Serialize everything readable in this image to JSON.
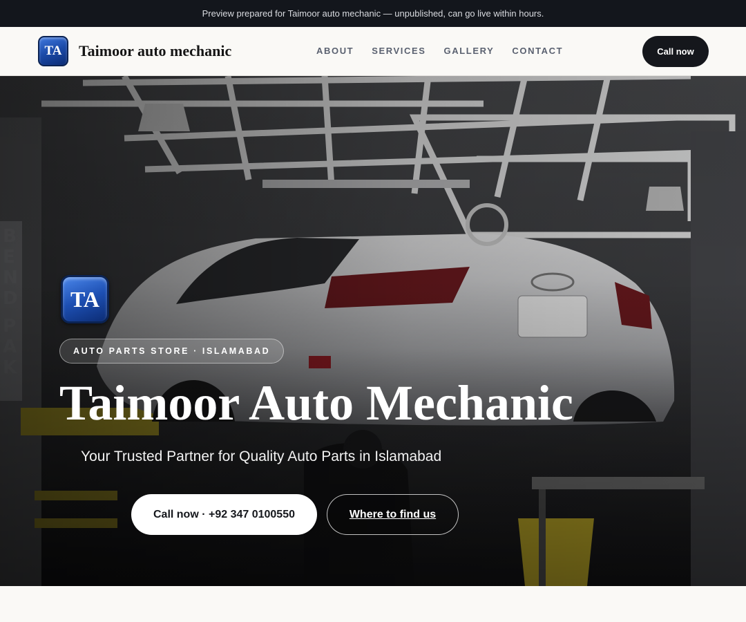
{
  "banner": {
    "text": "Preview prepared for Taimoor auto mechanic — unpublished, can go live within hours."
  },
  "nav": {
    "logo_text": "TA",
    "brand_name": "Taimoor auto mechanic",
    "links": [
      "ABOUT",
      "SERVICES",
      "GALLERY",
      "CONTACT"
    ],
    "cta_label": "Call now"
  },
  "hero": {
    "logo_text": "TA",
    "eyebrow": "AUTO PARTS STORE · ISLAMABAD",
    "title": "Taimoor Auto Mechanic",
    "subtitle": "Your Trusted Partner for Quality Auto Parts in Islamabad",
    "primary_button": "Call now · +92 347 0100550",
    "secondary_button": "Where to find us",
    "background_icon": "car-on-lift-photo"
  },
  "colors": {
    "topbar_bg": "#13161c",
    "nav_bg": "#faf9f6",
    "cta_bg": "#15171c",
    "logo_blue": "#1d4fb2"
  }
}
